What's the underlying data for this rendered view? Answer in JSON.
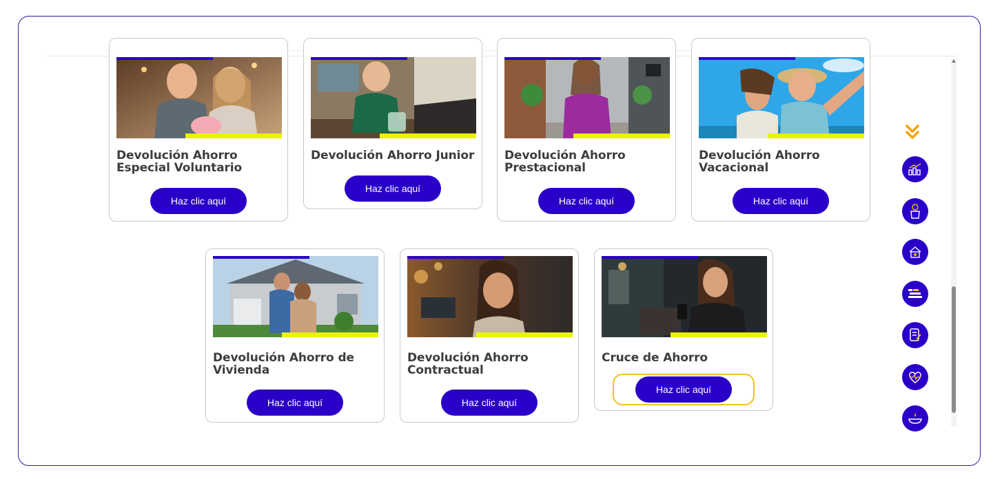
{
  "cards": [
    {
      "title_line1": "Devolución Ahorro",
      "title_line2": "Especial Voluntario",
      "button": "Haz clic aquí",
      "image": "couple-piggy-bank-photo"
    },
    {
      "title_line1": "Devolución Ahorro Junior",
      "title_line2": "",
      "button": "Haz clic aquí",
      "image": "child-coins-jar-photo"
    },
    {
      "title_line1": "Devolución Ahorro",
      "title_line2": "Prestacional",
      "button": "Haz clic aquí",
      "image": "woman-street-photo"
    },
    {
      "title_line1": "Devolución Ahorro",
      "title_line2": "Vacacional",
      "button": "Haz clic aquí",
      "image": "couple-beach-selfie-photo"
    },
    {
      "title_line1": "Devolución Ahorro de",
      "title_line2": "Vivienda",
      "button": "Haz clic aquí",
      "image": "couple-house-photo"
    },
    {
      "title_line1": "Devolución Ahorro",
      "title_line2": "Contractual",
      "button": "Haz clic aquí",
      "image": "woman-smiling-street-photo"
    },
    {
      "title_line1": "Cruce de Ahorro",
      "title_line2": "",
      "button": "Haz clic aquí",
      "image": "woman-phone-office-photo"
    }
  ],
  "side_nav": {
    "expand_icon": "double-chevron-down-icon",
    "icons": [
      "growth-chart-icon",
      "savings-jar-icon",
      "house-money-icon",
      "bienestar-icon",
      "document-edit-icon",
      "health-heart-icon",
      "plate-service-icon"
    ]
  },
  "colors": {
    "primary": "#2a00c8",
    "accent": "#eaf20a",
    "focus": "#f3c21a",
    "chevron": "#f5a200",
    "frame": "#3a12a8"
  }
}
